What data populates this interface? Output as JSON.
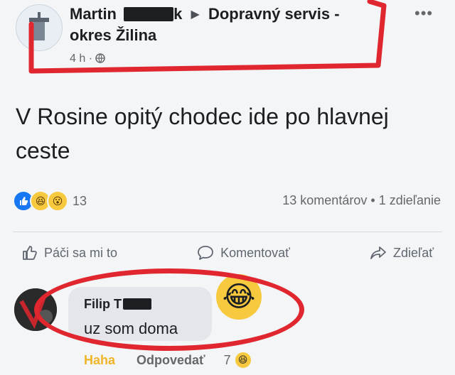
{
  "post": {
    "author": "Martin",
    "author_censored_tail": "k",
    "arrow": "▶",
    "group_line1": "Dopravný servis -",
    "group_line2": "okres Žilina",
    "time": "4 h",
    "dot": "·",
    "more": "•••",
    "text": "V Rosine opitý chodec ide po hlavnej ceste"
  },
  "reactions": {
    "count": "13",
    "comments": "13 komentárov",
    "sep": "•",
    "shares": "1 zdieľanie"
  },
  "actions": {
    "like": "Páči sa mi to",
    "comment": "Komentovať",
    "share": "Zdieľať"
  },
  "comment": {
    "name": "Filip T",
    "text": "uz som doma",
    "haha": "Haha",
    "reply": "Odpovedať",
    "reaction_count": "7"
  },
  "colors": {
    "annotation_red": "#e0262f",
    "like_blue": "#1877f2",
    "haha_yellow": "#f7c93e"
  }
}
